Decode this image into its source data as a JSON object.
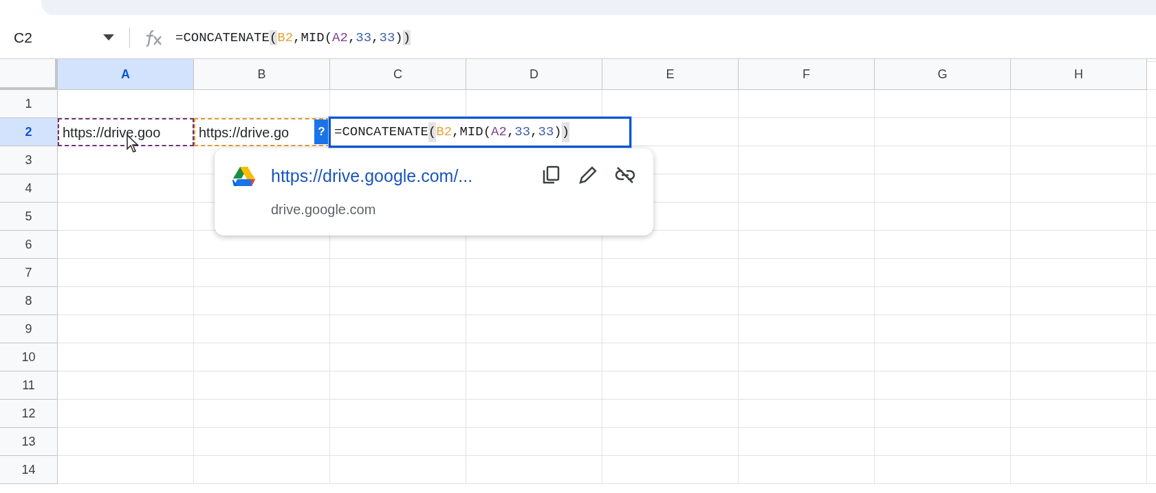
{
  "name_box": {
    "value": "C2"
  },
  "formula_bar": {
    "tokens": [
      {
        "text": "=CONCATENATE",
        "highlighted": false
      },
      {
        "text": "(",
        "highlighted": true
      },
      {
        "text": "B2",
        "highlighted": false,
        "color": "#e8a33a"
      },
      {
        "text": ",MID(",
        "highlighted": false
      },
      {
        "text": "A2",
        "highlighted": false,
        "color": "#7b3f8f"
      },
      {
        "text": ",",
        "highlighted": false
      },
      {
        "text": "33",
        "highlighted": false,
        "color": "#3d5fa8"
      },
      {
        "text": ",",
        "highlighted": false
      },
      {
        "text": "33",
        "highlighted": false,
        "color": "#3d5fa8"
      },
      {
        "text": ")",
        "highlighted": false
      },
      {
        "text": ")",
        "highlighted": true
      }
    ]
  },
  "columns": [
    {
      "label": "A",
      "selected": true
    },
    {
      "label": "B",
      "selected": false
    },
    {
      "label": "C",
      "selected": false
    },
    {
      "label": "D",
      "selected": false
    },
    {
      "label": "E",
      "selected": false
    },
    {
      "label": "F",
      "selected": false
    },
    {
      "label": "G",
      "selected": false
    },
    {
      "label": "H",
      "selected": false
    }
  ],
  "rows": [
    {
      "label": "1",
      "selected": false,
      "cells": []
    },
    {
      "label": "2",
      "selected": true,
      "cells": [
        {
          "text": "https://drive.goo",
          "color": "#6b2f7a"
        },
        {
          "text": "https://drive.go",
          "color": "#e09a2e"
        }
      ]
    },
    {
      "label": "3",
      "selected": false,
      "cells": []
    },
    {
      "label": "4",
      "selected": false,
      "cells": []
    },
    {
      "label": "5",
      "selected": false,
      "cells": []
    },
    {
      "label": "6",
      "selected": false,
      "cells": []
    },
    {
      "label": "7",
      "selected": false,
      "cells": []
    },
    {
      "label": "8",
      "selected": false,
      "cells": []
    },
    {
      "label": "9",
      "selected": false,
      "cells": []
    },
    {
      "label": "10",
      "selected": false,
      "cells": []
    },
    {
      "label": "11",
      "selected": false,
      "cells": []
    },
    {
      "label": "12",
      "selected": false,
      "cells": []
    },
    {
      "label": "13",
      "selected": false,
      "cells": []
    },
    {
      "label": "14",
      "selected": false,
      "cells": []
    }
  ],
  "cell_editor": {
    "help_badge": "?",
    "tokens": [
      {
        "text": "=CONCATENATE",
        "highlighted": false
      },
      {
        "text": "(",
        "highlighted": true
      },
      {
        "text": "B2",
        "highlighted": false,
        "color": "#e8a33a"
      },
      {
        "text": ",MID(",
        "highlighted": false
      },
      {
        "text": "A2",
        "highlighted": false,
        "color": "#7b3f8f"
      },
      {
        "text": ",",
        "highlighted": false
      },
      {
        "text": "33",
        "highlighted": false,
        "color": "#3d5fa8"
      },
      {
        "text": ",",
        "highlighted": false
      },
      {
        "text": "33",
        "highlighted": false,
        "color": "#3d5fa8"
      },
      {
        "text": ")",
        "highlighted": false
      },
      {
        "text": ")",
        "highlighted": true
      }
    ]
  },
  "link_popup": {
    "url": "https://drive.google.com/...",
    "domain": "drive.google.com"
  }
}
